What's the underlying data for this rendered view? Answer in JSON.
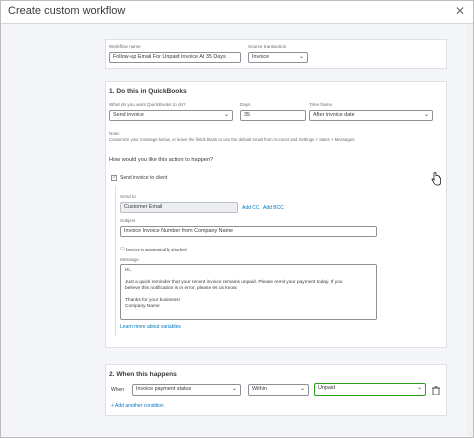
{
  "window": {
    "title": "Create custom workflow",
    "close_icon": "close-icon"
  },
  "top": {
    "workflow_name_label": "Workflow name",
    "workflow_name_value": "Follow-up Email For Unpaid Invoice At 35 Days",
    "source_label": "Source transaction",
    "source_value": "Invoice"
  },
  "do_this": {
    "title": "1. Do this in QuickBooks",
    "action_label": "What do you want QuickBooks to do?",
    "action_value": "Send invoice",
    "days_label": "Days",
    "days_value": "35",
    "timeframe_label": "Time frame",
    "timeframe_value": "After invoice date",
    "note_label": "Note:",
    "note_text": "Customize your message below, or leave the fields blank to use the default email from Account and Settings > Sales > Messages.",
    "how_text": "How would you like this action to happen?",
    "send_to_client_label": "Send invoice to client",
    "sendto_label": "Send to",
    "sendto_value": "Customer Email",
    "add_cc": "Add CC",
    "add_bcc": "Add BCC",
    "subject_label": "Subject",
    "subject_value": "Invoice Invoice Number from Company Name",
    "attached_text": "Invoice is automatically attached",
    "message_label": "Message",
    "message_lines": [
      "Hi,",
      "",
      "Just a quick reminder that your recent invoice remains unpaid. Please remit your payment today. If you",
      "believe this notification is in error, please let us know.",
      "",
      "Thanks for your business!",
      "Company Name"
    ],
    "learn_more": "Learn more about variables"
  },
  "when": {
    "title": "2. When this happens",
    "when_label": "When",
    "field_value": "Invoice payment status",
    "operator_value": "Within",
    "status_value": "Unpaid",
    "add_condition": "+ Add another condition"
  }
}
